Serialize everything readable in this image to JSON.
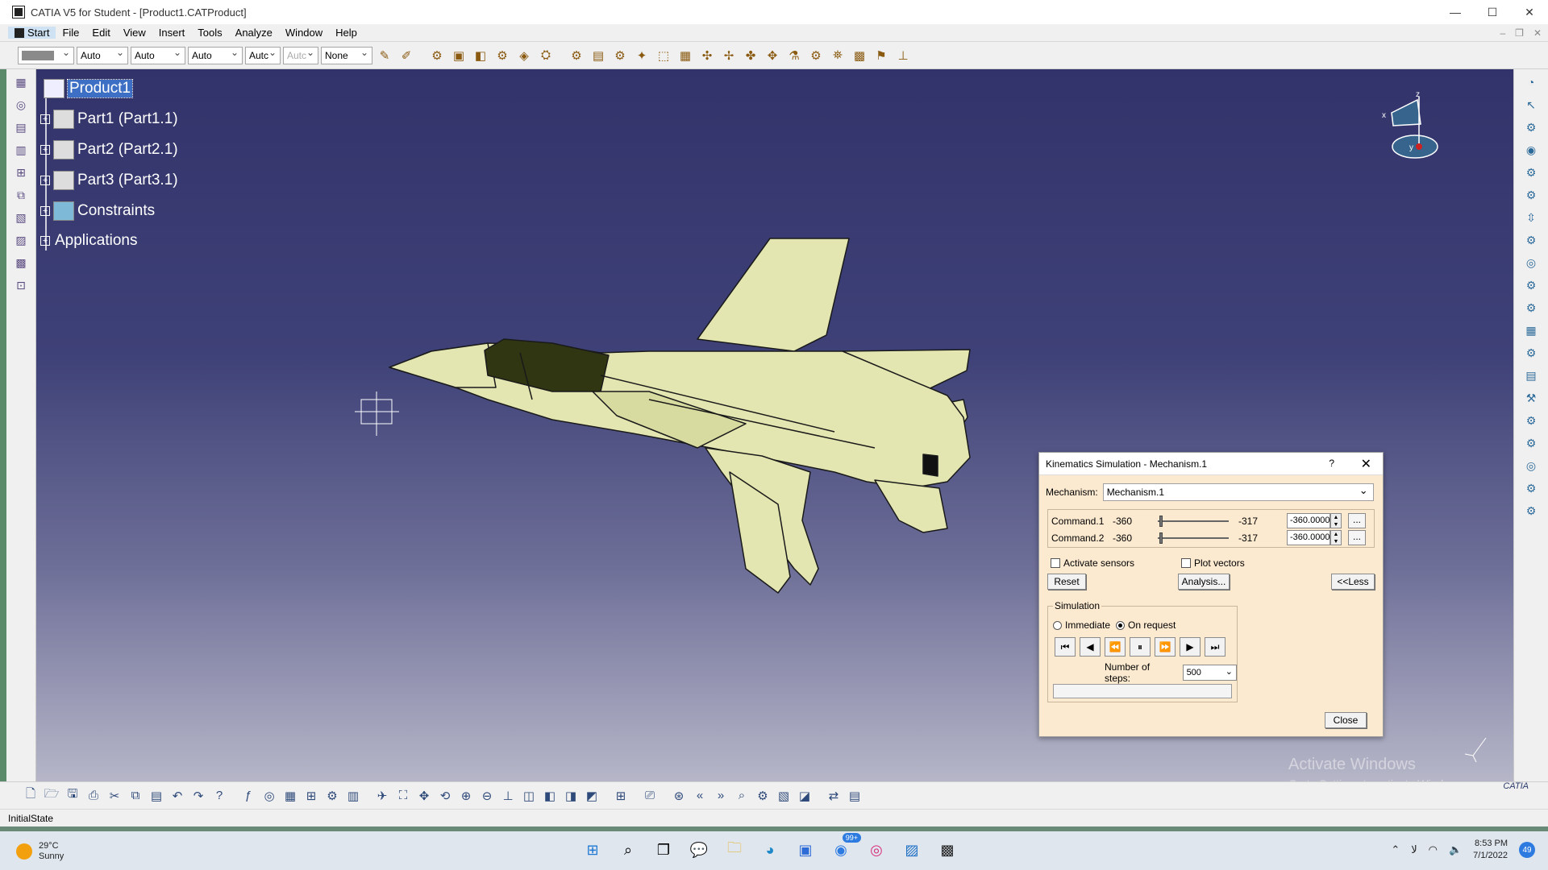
{
  "window": {
    "title": "CATIA V5 for Student - [Product1.CATProduct]",
    "controls": [
      "—",
      "☐",
      "✕"
    ]
  },
  "menu": {
    "items": [
      "Start",
      "File",
      "Edit",
      "View",
      "Insert",
      "Tools",
      "Analyze",
      "Window",
      "Help"
    ]
  },
  "toolbar": {
    "combos": [
      "Auto",
      "Auto",
      "Auto",
      "Autc",
      "Autc",
      "None"
    ]
  },
  "tree": {
    "root": "Product1",
    "nodes": [
      "Part1 (Part1.1)",
      "Part2 (Part2.1)",
      "Part3 (Part3.1)",
      "Constraints"
    ],
    "applications": "Applications"
  },
  "compass": {
    "x": "x",
    "y": "y",
    "z": "z"
  },
  "dialog": {
    "title": "Kinematics Simulation - Mechanism.1",
    "help": "?",
    "close_x": "✕",
    "mechanism_label": "Mechanism:",
    "mechanism_value": "Mechanism.1",
    "commands": [
      {
        "name": "Command.1",
        "min": "-360",
        "max": "-317",
        "value": "-360.0000"
      },
      {
        "name": "Command.2",
        "min": "-360",
        "max": "-317",
        "value": "-360.0000"
      }
    ],
    "dots": "...",
    "activate_sensors": "Activate sensors",
    "plot_vectors": "Plot vectors",
    "reset": "Reset",
    "analysis": "Analysis...",
    "less": "<<Less",
    "simulation_label": "Simulation",
    "immediate": "Immediate",
    "on_request": "On request",
    "steps_label": "Number of steps:",
    "steps_value": "500",
    "close": "Close"
  },
  "watermark": {
    "line1": "Activate Windows",
    "line2": "Go to Settings to activate Windows."
  },
  "status": {
    "text": "InitialState"
  },
  "logo": "CATIA",
  "taskbar": {
    "weather_temp": "29°C",
    "weather_desc": "Sunny",
    "badge": "99+",
    "time": "8:53 PM",
    "date": "7/1/2022",
    "notifications": "49"
  }
}
